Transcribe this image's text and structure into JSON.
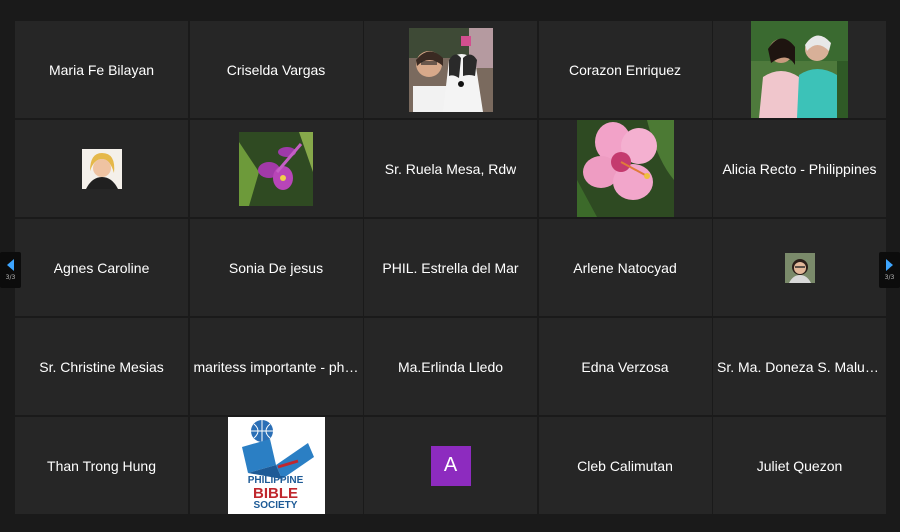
{
  "participants": [
    {
      "name": "Maria Fe Bilayan"
    },
    {
      "name": "Criselda Vargas"
    },
    {
      "photo": "woman-with-dog-photo"
    },
    {
      "name": "Corazon Enriquez"
    },
    {
      "photo": "two-women-photo"
    },
    {
      "photo": "woman-portrait-photo"
    },
    {
      "photo": "purple-orchid-photo"
    },
    {
      "name": "Sr. Ruela Mesa, Rdw"
    },
    {
      "photo": "pink-hibiscus-photo"
    },
    {
      "name": "Alicia Recto - Philippines"
    },
    {
      "name": "Agnes Caroline"
    },
    {
      "name": "Sonia De jesus"
    },
    {
      "name": "PHIL. Estrella del Mar"
    },
    {
      "name": "Arlene Natocyad"
    },
    {
      "photo": "woman-small-portrait-photo"
    },
    {
      "name": "Sr. Christine Mesias"
    },
    {
      "name": "maritess importante - philippines"
    },
    {
      "name": "Ma.Erlinda Lledo"
    },
    {
      "name": "Edna Verzosa"
    },
    {
      "name": "Sr. Ma. Doneza S. Malunes, Rdw"
    },
    {
      "name": "Than Trong Hung"
    },
    {
      "logo": "Philippine Bible Society logo",
      "logo_lines": [
        "PHILIPPINE",
        "BIBLE",
        "SOCIETY"
      ]
    },
    {
      "initial": "A"
    },
    {
      "name": "Cleb Calimutan"
    },
    {
      "name": "Juliet Quezon"
    }
  ],
  "pagination": {
    "left_page": "3/3",
    "right_page": "3/3"
  },
  "colors": {
    "tile_bg": "#262626",
    "page_bg": "#1a1a1a",
    "arrow": "#3da5ff",
    "initial_avatar": "#8d2bbf"
  }
}
